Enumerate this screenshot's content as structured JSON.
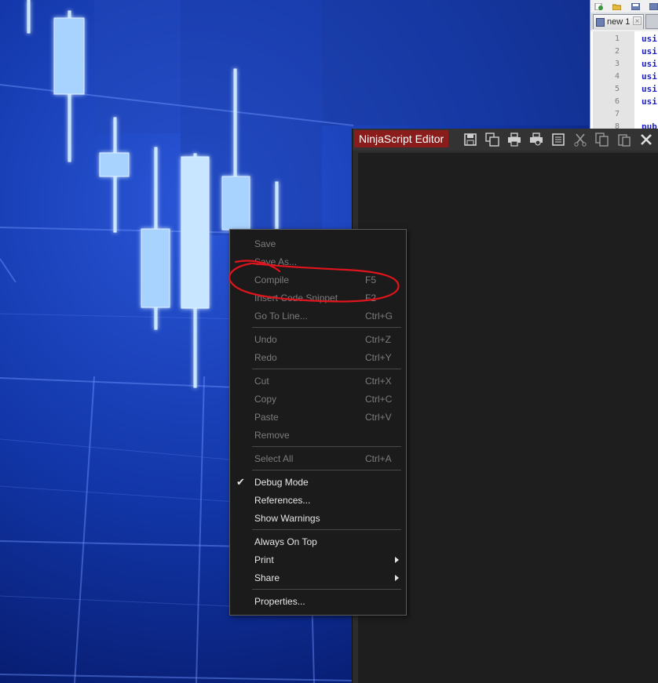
{
  "notepadpp": {
    "tab_label": "new 1",
    "tab_close_glyph": "×",
    "lines": [
      {
        "num": "1",
        "code": "usi"
      },
      {
        "num": "2",
        "code": "usi"
      },
      {
        "num": "3",
        "code": "usi"
      },
      {
        "num": "4",
        "code": "usi"
      },
      {
        "num": "5",
        "code": "usi"
      },
      {
        "num": "6",
        "code": "usi"
      },
      {
        "num": "7",
        "code": ""
      },
      {
        "num": "8",
        "code": "pub"
      }
    ]
  },
  "ninjascript_editor": {
    "title": "NinjaScript Editor",
    "title_bg_color": "#8a1c1c",
    "toolbar_icons": [
      "save-icon",
      "save-all-icon",
      "print-icon",
      "print-preview-icon",
      "page-setup-icon",
      "cut-icon",
      "copy-icon",
      "paste-icon",
      "close-icon"
    ]
  },
  "context_menu": {
    "items": {
      "save": {
        "label": "Save",
        "shortcut": "",
        "enabled": false
      },
      "save_as": {
        "label": "Save As...",
        "shortcut": "",
        "enabled": false
      },
      "compile": {
        "label": "Compile",
        "shortcut": "F5",
        "enabled": false
      },
      "insert_snippet": {
        "label": "Insert Code Snippet",
        "shortcut": "F2",
        "enabled": false
      },
      "go_to_line": {
        "label": "Go To Line...",
        "shortcut": "Ctrl+G",
        "enabled": false
      },
      "undo": {
        "label": "Undo",
        "shortcut": "Ctrl+Z",
        "enabled": false
      },
      "redo": {
        "label": "Redo",
        "shortcut": "Ctrl+Y",
        "enabled": false
      },
      "cut": {
        "label": "Cut",
        "shortcut": "Ctrl+X",
        "enabled": false
      },
      "copy": {
        "label": "Copy",
        "shortcut": "Ctrl+C",
        "enabled": false
      },
      "paste": {
        "label": "Paste",
        "shortcut": "Ctrl+V",
        "enabled": false
      },
      "remove": {
        "label": "Remove",
        "shortcut": "",
        "enabled": false
      },
      "select_all": {
        "label": "Select All",
        "shortcut": "Ctrl+A",
        "enabled": false
      },
      "debug_mode": {
        "label": "Debug Mode",
        "checked": true,
        "check_glyph": "✔",
        "enabled": true
      },
      "references": {
        "label": "References...",
        "enabled": true
      },
      "show_warnings": {
        "label": "Show Warnings",
        "enabled": true
      },
      "always_on_top": {
        "label": "Always On Top",
        "enabled": true
      },
      "print": {
        "label": "Print",
        "has_submenu": true,
        "enabled": true
      },
      "share": {
        "label": "Share",
        "has_submenu": true,
        "enabled": true
      },
      "properties": {
        "label": "Properties...",
        "enabled": true
      }
    }
  },
  "annotation": {
    "color": "#e0141c",
    "target": "Compile / Insert Code Snippet"
  }
}
